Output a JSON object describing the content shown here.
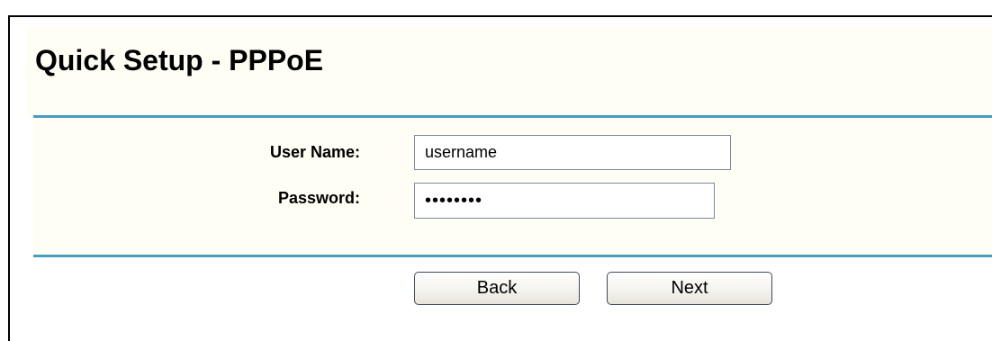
{
  "page": {
    "title": "Quick Setup - PPPoE"
  },
  "form": {
    "user_name_label": "User Name:",
    "user_name_value": "username",
    "password_label": "Password:",
    "password_value": "password"
  },
  "buttons": {
    "back_label": "Back",
    "next_label": "Next"
  },
  "colors": {
    "rule": "#4a9bc0",
    "band_background": "#fffef4"
  }
}
